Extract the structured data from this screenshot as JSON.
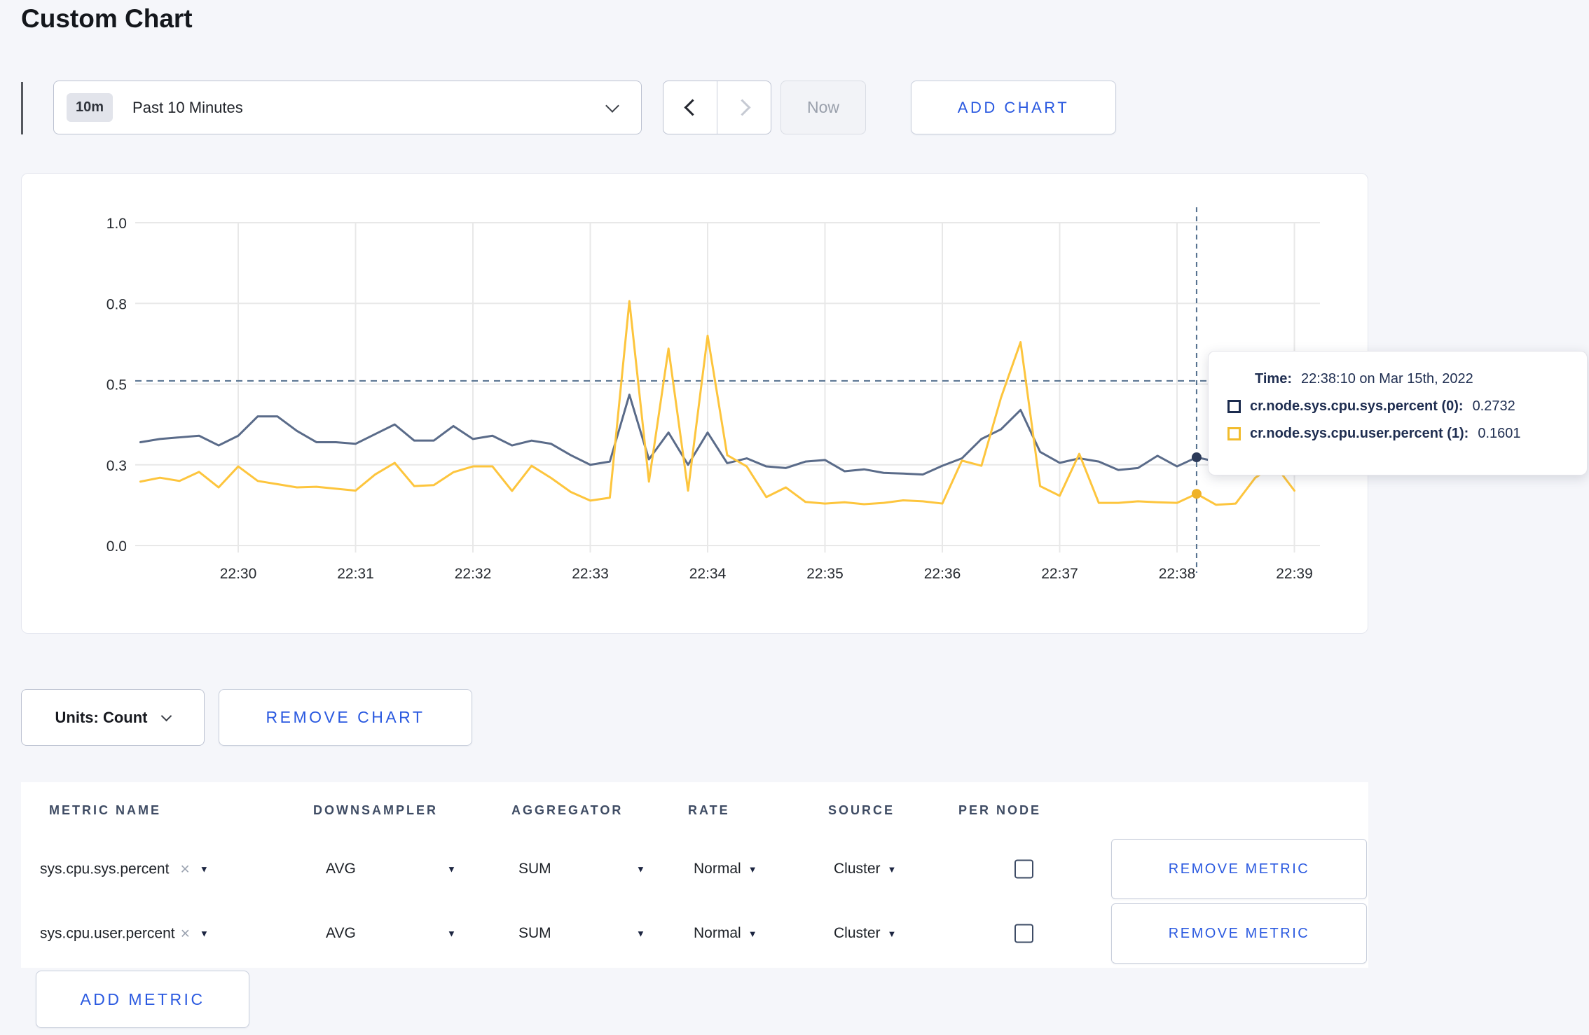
{
  "page": {
    "title": "Custom Chart"
  },
  "toolbar": {
    "range_badge": "10m",
    "range_label": "Past 10 Minutes",
    "now_label": "Now",
    "add_chart_label": "ADD CHART"
  },
  "controls": {
    "units_label": "Units: Count",
    "remove_chart_label": "REMOVE CHART",
    "add_metric_label": "ADD METRIC"
  },
  "icons": {
    "caret_down": "▼",
    "clear": "×"
  },
  "colors": {
    "accent_blue": "#2a59e0",
    "series_sys": "#5a6b89",
    "series_sys_dot": "#2c3a59",
    "series_user": "#fdc53d",
    "series_user_dot": "#efb229",
    "crosshair": "#54708e",
    "grid": "#e8e8e8"
  },
  "tooltip": {
    "time_label": "Time:",
    "time_value": "22:38:10 on Mar 15th, 2022",
    "series": [
      {
        "label": "cr.node.sys.cpu.sys.percent (0):",
        "value": "0.2732",
        "color": "#1b2b4e"
      },
      {
        "label": "cr.node.sys.cpu.user.percent (1):",
        "value": "0.1601",
        "color": "#f2bc2d"
      }
    ]
  },
  "table": {
    "headers": [
      "METRIC NAME",
      "DOWNSAMPLER",
      "AGGREGATOR",
      "RATE",
      "SOURCE",
      "PER NODE"
    ],
    "remove_metric_label": "REMOVE METRIC",
    "metrics": [
      {
        "name": "sys.cpu.sys.percent",
        "downsampler": "AVG",
        "aggregator": "SUM",
        "rate": "Normal",
        "source": "Cluster",
        "per_node_checked": false
      },
      {
        "name": "sys.cpu.user.percent",
        "downsampler": "AVG",
        "aggregator": "SUM",
        "rate": "Normal",
        "source": "Cluster",
        "per_node_checked": false
      }
    ]
  },
  "chart_data": {
    "type": "line",
    "title": "",
    "x_start": "22:29:10",
    "x_interval_seconds": 10,
    "x_tick_labels": [
      "22:30",
      "22:31",
      "22:32",
      "22:33",
      "22:34",
      "22:35",
      "22:36",
      "22:37",
      "22:38",
      "22:39"
    ],
    "y_ticks": [
      {
        "label": "0.0",
        "value": 0
      },
      {
        "label": "0.3",
        "value": 0.25
      },
      {
        "label": "0.5",
        "value": 0.5
      },
      {
        "label": "0.8",
        "value": 0.75
      },
      {
        "label": "1.0",
        "value": 1
      }
    ],
    "ylim": [
      0,
      1
    ],
    "grid": true,
    "series": [
      {
        "name": "cr.node.sys.cpu.sys.percent",
        "values": [
          0.32,
          0.33,
          0.335,
          0.34,
          0.31,
          0.34,
          0.4,
          0.4,
          0.355,
          0.32,
          0.32,
          0.315,
          0.345,
          0.375,
          0.325,
          0.325,
          0.37,
          0.33,
          0.34,
          0.31,
          0.325,
          0.315,
          0.28,
          0.25,
          0.26,
          0.467,
          0.267,
          0.35,
          0.25,
          0.35,
          0.255,
          0.27,
          0.245,
          0.24,
          0.26,
          0.265,
          0.23,
          0.236,
          0.225,
          0.223,
          0.22,
          0.247,
          0.27,
          0.33,
          0.36,
          0.42,
          0.29,
          0.256,
          0.27,
          0.26,
          0.234,
          0.24,
          0.278,
          0.245,
          0.2732,
          0.26
        ]
      },
      {
        "name": "cr.node.sys.cpu.user.percent",
        "values": [
          0.198,
          0.21,
          0.2,
          0.228,
          0.18,
          0.245,
          0.2,
          0.19,
          0.18,
          0.182,
          0.176,
          0.17,
          0.22,
          0.256,
          0.184,
          0.187,
          0.227,
          0.245,
          0.245,
          0.169,
          0.247,
          0.209,
          0.166,
          0.139,
          0.148,
          0.757,
          0.198,
          0.61,
          0.17,
          0.65,
          0.28,
          0.245,
          0.15,
          0.18,
          0.135,
          0.13,
          0.134,
          0.128,
          0.132,
          0.14,
          0.137,
          0.13,
          0.263,
          0.247,
          0.458,
          0.63,
          0.184,
          0.154,
          0.284,
          0.132,
          0.132,
          0.137,
          0.134,
          0.132,
          0.1601,
          0.126,
          0.13,
          0.21,
          0.25,
          0.17
        ]
      }
    ],
    "hover": {
      "index": 54,
      "time": "22:38:10",
      "values": [
        0.2732,
        0.1601
      ],
      "crosshair_y": 0.51
    }
  }
}
